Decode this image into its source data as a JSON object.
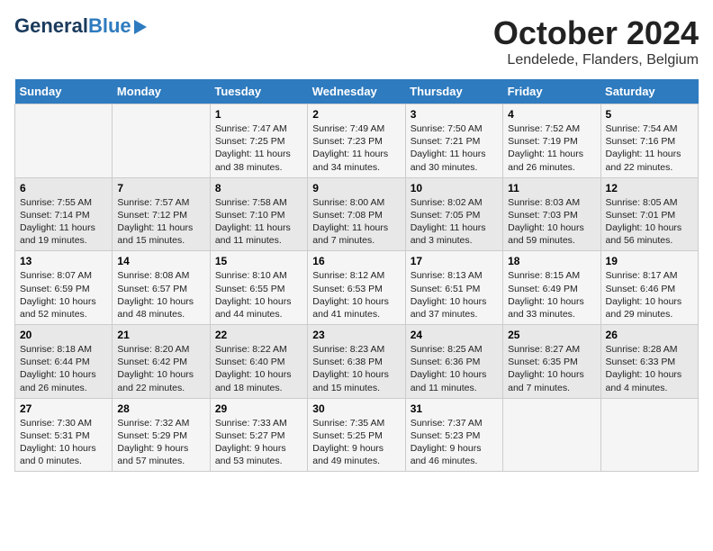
{
  "header": {
    "logo_general": "General",
    "logo_blue": "Blue",
    "title": "October 2024",
    "subtitle": "Lendelede, Flanders, Belgium"
  },
  "days_of_week": [
    "Sunday",
    "Monday",
    "Tuesday",
    "Wednesday",
    "Thursday",
    "Friday",
    "Saturday"
  ],
  "weeks": [
    [
      {
        "day": "",
        "sunrise": "",
        "sunset": "",
        "daylight": ""
      },
      {
        "day": "",
        "sunrise": "",
        "sunset": "",
        "daylight": ""
      },
      {
        "day": "1",
        "sunrise": "Sunrise: 7:47 AM",
        "sunset": "Sunset: 7:25 PM",
        "daylight": "Daylight: 11 hours and 38 minutes."
      },
      {
        "day": "2",
        "sunrise": "Sunrise: 7:49 AM",
        "sunset": "Sunset: 7:23 PM",
        "daylight": "Daylight: 11 hours and 34 minutes."
      },
      {
        "day": "3",
        "sunrise": "Sunrise: 7:50 AM",
        "sunset": "Sunset: 7:21 PM",
        "daylight": "Daylight: 11 hours and 30 minutes."
      },
      {
        "day": "4",
        "sunrise": "Sunrise: 7:52 AM",
        "sunset": "Sunset: 7:19 PM",
        "daylight": "Daylight: 11 hours and 26 minutes."
      },
      {
        "day": "5",
        "sunrise": "Sunrise: 7:54 AM",
        "sunset": "Sunset: 7:16 PM",
        "daylight": "Daylight: 11 hours and 22 minutes."
      }
    ],
    [
      {
        "day": "6",
        "sunrise": "Sunrise: 7:55 AM",
        "sunset": "Sunset: 7:14 PM",
        "daylight": "Daylight: 11 hours and 19 minutes."
      },
      {
        "day": "7",
        "sunrise": "Sunrise: 7:57 AM",
        "sunset": "Sunset: 7:12 PM",
        "daylight": "Daylight: 11 hours and 15 minutes."
      },
      {
        "day": "8",
        "sunrise": "Sunrise: 7:58 AM",
        "sunset": "Sunset: 7:10 PM",
        "daylight": "Daylight: 11 hours and 11 minutes."
      },
      {
        "day": "9",
        "sunrise": "Sunrise: 8:00 AM",
        "sunset": "Sunset: 7:08 PM",
        "daylight": "Daylight: 11 hours and 7 minutes."
      },
      {
        "day": "10",
        "sunrise": "Sunrise: 8:02 AM",
        "sunset": "Sunset: 7:05 PM",
        "daylight": "Daylight: 11 hours and 3 minutes."
      },
      {
        "day": "11",
        "sunrise": "Sunrise: 8:03 AM",
        "sunset": "Sunset: 7:03 PM",
        "daylight": "Daylight: 10 hours and 59 minutes."
      },
      {
        "day": "12",
        "sunrise": "Sunrise: 8:05 AM",
        "sunset": "Sunset: 7:01 PM",
        "daylight": "Daylight: 10 hours and 56 minutes."
      }
    ],
    [
      {
        "day": "13",
        "sunrise": "Sunrise: 8:07 AM",
        "sunset": "Sunset: 6:59 PM",
        "daylight": "Daylight: 10 hours and 52 minutes."
      },
      {
        "day": "14",
        "sunrise": "Sunrise: 8:08 AM",
        "sunset": "Sunset: 6:57 PM",
        "daylight": "Daylight: 10 hours and 48 minutes."
      },
      {
        "day": "15",
        "sunrise": "Sunrise: 8:10 AM",
        "sunset": "Sunset: 6:55 PM",
        "daylight": "Daylight: 10 hours and 44 minutes."
      },
      {
        "day": "16",
        "sunrise": "Sunrise: 8:12 AM",
        "sunset": "Sunset: 6:53 PM",
        "daylight": "Daylight: 10 hours and 41 minutes."
      },
      {
        "day": "17",
        "sunrise": "Sunrise: 8:13 AM",
        "sunset": "Sunset: 6:51 PM",
        "daylight": "Daylight: 10 hours and 37 minutes."
      },
      {
        "day": "18",
        "sunrise": "Sunrise: 8:15 AM",
        "sunset": "Sunset: 6:49 PM",
        "daylight": "Daylight: 10 hours and 33 minutes."
      },
      {
        "day": "19",
        "sunrise": "Sunrise: 8:17 AM",
        "sunset": "Sunset: 6:46 PM",
        "daylight": "Daylight: 10 hours and 29 minutes."
      }
    ],
    [
      {
        "day": "20",
        "sunrise": "Sunrise: 8:18 AM",
        "sunset": "Sunset: 6:44 PM",
        "daylight": "Daylight: 10 hours and 26 minutes."
      },
      {
        "day": "21",
        "sunrise": "Sunrise: 8:20 AM",
        "sunset": "Sunset: 6:42 PM",
        "daylight": "Daylight: 10 hours and 22 minutes."
      },
      {
        "day": "22",
        "sunrise": "Sunrise: 8:22 AM",
        "sunset": "Sunset: 6:40 PM",
        "daylight": "Daylight: 10 hours and 18 minutes."
      },
      {
        "day": "23",
        "sunrise": "Sunrise: 8:23 AM",
        "sunset": "Sunset: 6:38 PM",
        "daylight": "Daylight: 10 hours and 15 minutes."
      },
      {
        "day": "24",
        "sunrise": "Sunrise: 8:25 AM",
        "sunset": "Sunset: 6:36 PM",
        "daylight": "Daylight: 10 hours and 11 minutes."
      },
      {
        "day": "25",
        "sunrise": "Sunrise: 8:27 AM",
        "sunset": "Sunset: 6:35 PM",
        "daylight": "Daylight: 10 hours and 7 minutes."
      },
      {
        "day": "26",
        "sunrise": "Sunrise: 8:28 AM",
        "sunset": "Sunset: 6:33 PM",
        "daylight": "Daylight: 10 hours and 4 minutes."
      }
    ],
    [
      {
        "day": "27",
        "sunrise": "Sunrise: 7:30 AM",
        "sunset": "Sunset: 5:31 PM",
        "daylight": "Daylight: 10 hours and 0 minutes."
      },
      {
        "day": "28",
        "sunrise": "Sunrise: 7:32 AM",
        "sunset": "Sunset: 5:29 PM",
        "daylight": "Daylight: 9 hours and 57 minutes."
      },
      {
        "day": "29",
        "sunrise": "Sunrise: 7:33 AM",
        "sunset": "Sunset: 5:27 PM",
        "daylight": "Daylight: 9 hours and 53 minutes."
      },
      {
        "day": "30",
        "sunrise": "Sunrise: 7:35 AM",
        "sunset": "Sunset: 5:25 PM",
        "daylight": "Daylight: 9 hours and 49 minutes."
      },
      {
        "day": "31",
        "sunrise": "Sunrise: 7:37 AM",
        "sunset": "Sunset: 5:23 PM",
        "daylight": "Daylight: 9 hours and 46 minutes."
      },
      {
        "day": "",
        "sunrise": "",
        "sunset": "",
        "daylight": ""
      },
      {
        "day": "",
        "sunrise": "",
        "sunset": "",
        "daylight": ""
      }
    ]
  ]
}
